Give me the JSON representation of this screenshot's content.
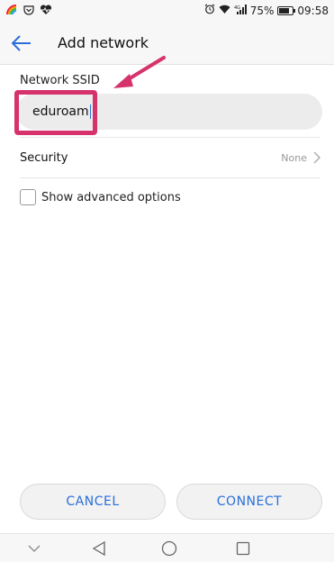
{
  "status_bar": {
    "battery_percent": "75%",
    "time": "09:58",
    "signal_label": "4G"
  },
  "app_bar": {
    "title": "Add network"
  },
  "form": {
    "ssid_label": "Network SSID",
    "ssid_value": "eduroam",
    "security_label": "Security",
    "security_value": "None",
    "advanced_label": "Show advanced options",
    "advanced_checked": false
  },
  "buttons": {
    "cancel_label": "CANCEL",
    "connect_label": "CONNECT"
  },
  "colors": {
    "accent": "#2a6fd9",
    "annotation": "#d6336c"
  },
  "icons": {
    "back": "back-arrow-icon",
    "chevron": "chevron-right-icon",
    "nav_back": "triangle-back-icon",
    "nav_home": "circle-home-icon",
    "nav_recent": "square-recent-icon",
    "nav_hide": "chevron-down-icon"
  }
}
